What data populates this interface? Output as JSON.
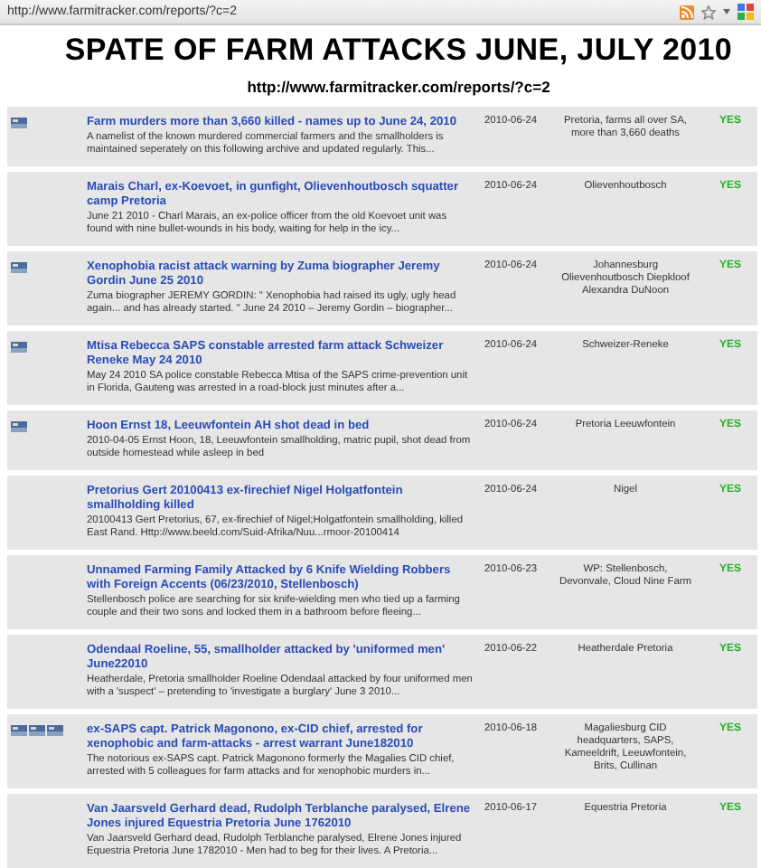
{
  "address_bar": {
    "url": "http://www.farmitracker.com/reports/?c=2"
  },
  "heading": {
    "title": "SPATE OF FARM ATTACKS JUNE, JULY 2010",
    "subtitle": "http://www.farmitracker.com/reports/?c=2"
  },
  "rows": [
    {
      "kind": "photo",
      "title": "Farm murders more than 3,660 killed - names up to June 24, 2010",
      "summary": "A namelist of the known murdered commercial farmers and the smallholders is maintained seperately on this following archive and updated regularly. This...",
      "date": "2010-06-24",
      "location": "Pretoria, farms all over SA, more than 3,660 deaths",
      "verified": "YES"
    },
    {
      "kind": "plain",
      "title": "Marais Charl, ex-Koevoet, in gunfight, Olievenhoutbosch squatter camp Pretoria",
      "summary": "June 21 2010 - Charl Marais, an ex-police officer from the old Koevoet unit was found with nine bullet-wounds in his body, waiting for help in the icy...",
      "date": "2010-06-24",
      "location": "Olievenhoutbosch",
      "verified": "YES"
    },
    {
      "kind": "photo",
      "title": "Xenophobia racist attack warning by Zuma biographer Jeremy Gordin June 25 2010",
      "summary": "Zuma biographer JEREMY GORDIN: \" Xenophobia had raised its ugly, ugly head again... and has already started. \" June 24 2010 – Jeremy Gordin – biographer...",
      "date": "2010-06-24",
      "location": "Johannesburg Olievenhoutbosch Diepkloof Alexandra DuNoon",
      "verified": "YES"
    },
    {
      "kind": "photo",
      "title": "Mtisa Rebecca SAPS constable arrested farm attack Schweizer Reneke May 24 2010",
      "summary": "May 24 2010 SA police constable Rebecca Mtisa of the SAPS crime-prevention unit in Florida, Gauteng was arrested in a road-block just minutes after a...",
      "date": "2010-06-24",
      "location": "Schweizer-Reneke",
      "verified": "YES"
    },
    {
      "kind": "photo",
      "title": "Hoon Ernst 18, Leeuwfontein AH shot dead in bed",
      "summary": "2010-04-05 Ernst Hoon, 18, Leeuwfontein smallholding, matric pupil, shot dead from outside homestead while asleep in bed",
      "date": "2010-06-24",
      "location": "Pretoria Leeuwfontein",
      "verified": "YES"
    },
    {
      "kind": "plain",
      "title": "Pretorius Gert 20100413 ex-firechief Nigel Holgatfontein smallholding killed",
      "summary": "20100413 Gert Pretorius, 67, ex-firechief of Nigel;Holgatfontein smallholding, killed East Rand. Http://www.beeld.com/Suid-Afrika/Nuu...rmoor-20100414",
      "date": "2010-06-24",
      "location": "Nigel",
      "verified": "YES"
    },
    {
      "kind": "plain",
      "title": "Unnamed Farming Family Attacked by 6 Knife Wielding Robbers with Foreign Accents (06/23/2010, Stellenbosch)",
      "summary": "Stellenbosch police are searching for six knife-wielding men who tied up a farming couple and their two sons and locked them in a bathroom before fleeing...",
      "date": "2010-06-23",
      "location": "WP: Stellenbosch, Devonvale, Cloud Nine Farm",
      "verified": "YES"
    },
    {
      "kind": "plain",
      "title": "Odendaal Roeline, 55, smallholder attacked by 'uniformed men' June22010",
      "summary": "Heatherdale, Pretoria smallholder Roeline Odendaal attacked by four uniformed men with a 'suspect' – pretending to 'investigate a burglary' June 3 2010...",
      "date": "2010-06-22",
      "location": "Heatherdale Pretoria",
      "verified": "YES"
    },
    {
      "kind": "gallery",
      "title": "ex-SAPS capt. Patrick Magonono, ex-CID chief, arrested for xenophobic and farm-attacks - arrest warrant June182010",
      "summary": "The notorious ex-SAPS capt. Patrick Magonono formerly the Magalies CID chief, arrested with 5 colleagues for farm attacks and for xenophobic murders in...",
      "date": "2010-06-18",
      "location": "Magaliesburg CID headquarters, SAPS, Kameeldrift, Leeuwfontein, Brits, Cullinan",
      "verified": "YES"
    },
    {
      "kind": "plain",
      "title": "Van Jaarsveld Gerhard dead, Rudolph Terblanche paralysed, Elrene Jones injured Equestria Pretoria June 1762010",
      "summary": "Van Jaarsveld Gerhard dead, Rudolph Terblanche paralysed, Elrene Jones injured Equestria Pretoria June 1782010 - Men had to beg for their lives. A Pretoria...",
      "date": "2010-06-17",
      "location": "Equestria Pretoria",
      "verified": "YES"
    }
  ]
}
